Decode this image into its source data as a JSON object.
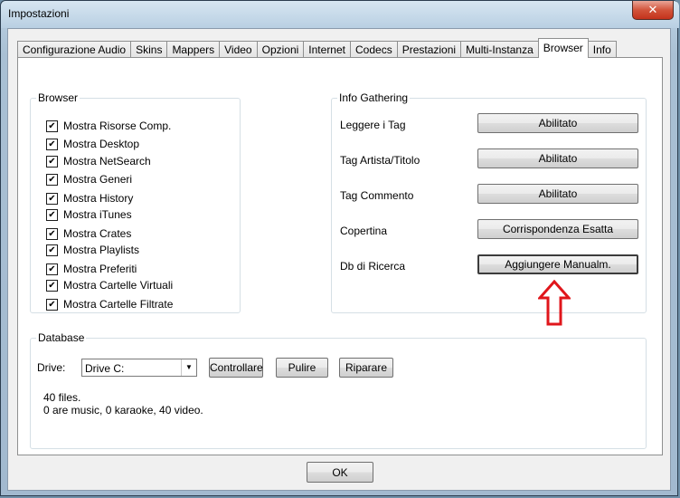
{
  "window": {
    "title": "Impostazioni",
    "close_glyph": "✕"
  },
  "tabs": [
    {
      "label": "Configurazione Audio"
    },
    {
      "label": "Skins"
    },
    {
      "label": "Mappers"
    },
    {
      "label": "Video"
    },
    {
      "label": "Opzioni"
    },
    {
      "label": "Internet"
    },
    {
      "label": "Codecs"
    },
    {
      "label": "Prestazioni"
    },
    {
      "label": "Multi-Instanza"
    },
    {
      "label": "Browser",
      "active": true
    },
    {
      "label": "Info"
    }
  ],
  "browser": {
    "legend": "Browser",
    "items": [
      {
        "label": "Mostra Risorse Comp.",
        "checked": true
      },
      {
        "label": "Mostra Desktop",
        "checked": true
      },
      {
        "label": "Mostra NetSearch",
        "checked": true
      },
      {
        "label": "Mostra Generi",
        "checked": true
      },
      {
        "label": "Mostra History",
        "checked": true
      },
      {
        "label": "Mostra iTunes",
        "checked": true
      },
      {
        "label": "Mostra Crates",
        "checked": true
      },
      {
        "label": "Mostra Playlists",
        "checked": true
      },
      {
        "label": "Mostra Preferiti",
        "checked": true
      },
      {
        "label": "Mostra Cartelle Virtuali",
        "checked": true
      },
      {
        "label": "Mostra Cartelle Filtrate",
        "checked": true
      }
    ],
    "check_glyph": "✔"
  },
  "info_gathering": {
    "legend": "Info Gathering",
    "rows": [
      {
        "label": "Leggere i Tag",
        "value": "Abilitato"
      },
      {
        "label": "Tag Artista/Titolo",
        "value": "Abilitato"
      },
      {
        "label": "Tag Commento",
        "value": "Abilitato"
      },
      {
        "label": "Copertina",
        "value": "Corrispondenza Esatta"
      },
      {
        "label": "Db di Ricerca",
        "value": "Aggiungere Manualm."
      }
    ]
  },
  "database": {
    "legend": "Database",
    "drive_label": "Drive:",
    "drive_value": "Drive C:",
    "check_button": "Controllare",
    "clean_button": "Pulire",
    "repair_button": "Riparare",
    "stats_line1": "40 files.",
    "stats_line2": "0 are music, 0 karaoke, 40 video."
  },
  "footer": {
    "ok_label": "OK"
  },
  "colors": {
    "annotation_arrow": "#e0161b"
  }
}
